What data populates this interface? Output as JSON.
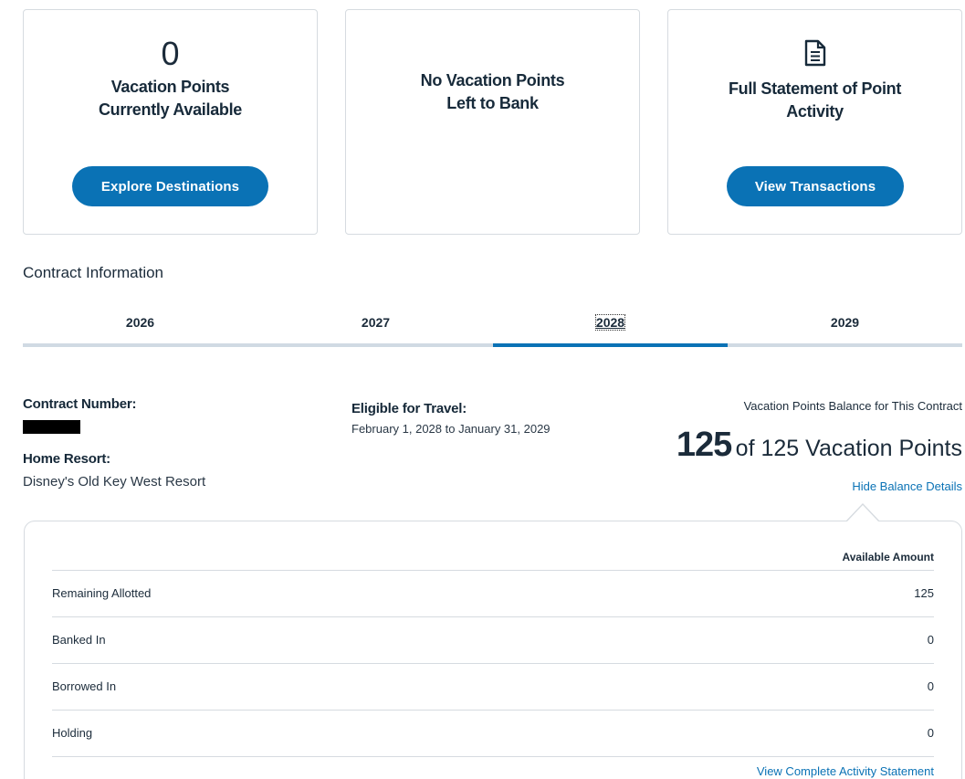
{
  "cards": {
    "available": {
      "count": "0",
      "line1": "Vacation Points",
      "line2": "Currently Available",
      "button": "Explore Destinations"
    },
    "bank": {
      "line1": "No Vacation Points",
      "line2": "Left to Bank"
    },
    "statement": {
      "icon": "document-icon",
      "line1": "Full Statement of Point",
      "line2": "Activity",
      "button": "View Transactions"
    }
  },
  "section_title": "Contract Information",
  "tabs": [
    {
      "label": "2026"
    },
    {
      "label": "2027"
    },
    {
      "label": "2028",
      "active": true
    },
    {
      "label": "2029"
    }
  ],
  "contract": {
    "number_label": "Contract Number:",
    "home_label": "Home Resort:",
    "home_value": "Disney's Old Key West Resort",
    "travel_label": "Eligible for Travel:",
    "travel_value": "February 1, 2028 to January 31, 2029"
  },
  "balance": {
    "label": "Vacation Points Balance for This Contract",
    "current": "125",
    "rest": "of 125 Vacation Points",
    "toggle": "Hide Balance Details"
  },
  "details": {
    "header": "Available Amount",
    "rows": [
      {
        "label": "Remaining Allotted",
        "value": "125"
      },
      {
        "label": "Banked In",
        "value": "0"
      },
      {
        "label": "Borrowed In",
        "value": "0"
      },
      {
        "label": "Holding",
        "value": "0"
      }
    ],
    "link": "View Complete Activity Statement"
  },
  "colors": {
    "accent": "#0a72b5",
    "border": "#d6dbe0",
    "text": "#1b2b3a"
  }
}
